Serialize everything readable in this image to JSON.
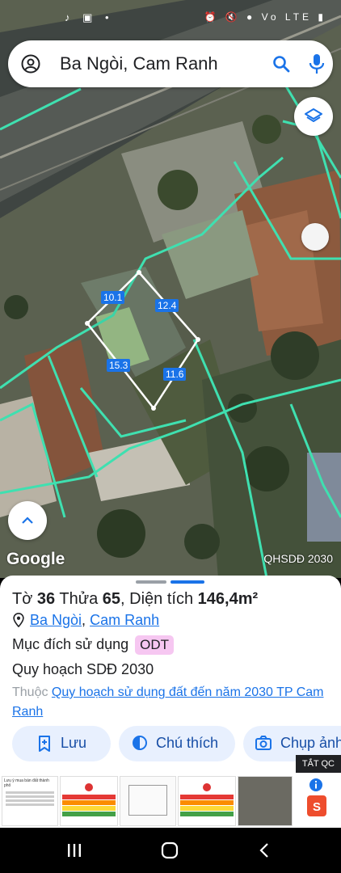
{
  "status_bar": {
    "time": "",
    "left_icons": "♪ ▣ •",
    "right_icons": "⏰ 🔇 ● Vo LTE ▮"
  },
  "search": {
    "query": "Ba Ngòi, Cam Ranh"
  },
  "map": {
    "google_label": "Google",
    "layer_label": "QHSDĐ 2030",
    "measurements": {
      "top": "10.1",
      "right": "12.4",
      "left": "15.3",
      "bottom": "11.6"
    }
  },
  "parcel": {
    "sheet_prefix": "Tờ",
    "sheet_number": "36",
    "plot_prefix": "Thửa",
    "plot_number": "65",
    "area_prefix": ", Diện tích",
    "area_value": "146,4m²",
    "location_1": "Ba Ngòi",
    "location_sep": ",",
    "location_2": "Cam Ranh",
    "purpose_label": "Mục đích sử dụng",
    "purpose_code": "ODT",
    "planning_label": "Quy hoạch SDĐ 2030",
    "belongs_label": "Thuộc",
    "belongs_link": "Quy hoạch sử dụng đất đến năm 2030 TP Cam Ranh"
  },
  "actions": {
    "save": "Lưu",
    "legend": "Chú thích",
    "capture": "Chụp ảnh"
  },
  "ad": {
    "close_label": "TẮT QC",
    "thumb_title": "Lưu ý mua bán đất thành phố"
  }
}
